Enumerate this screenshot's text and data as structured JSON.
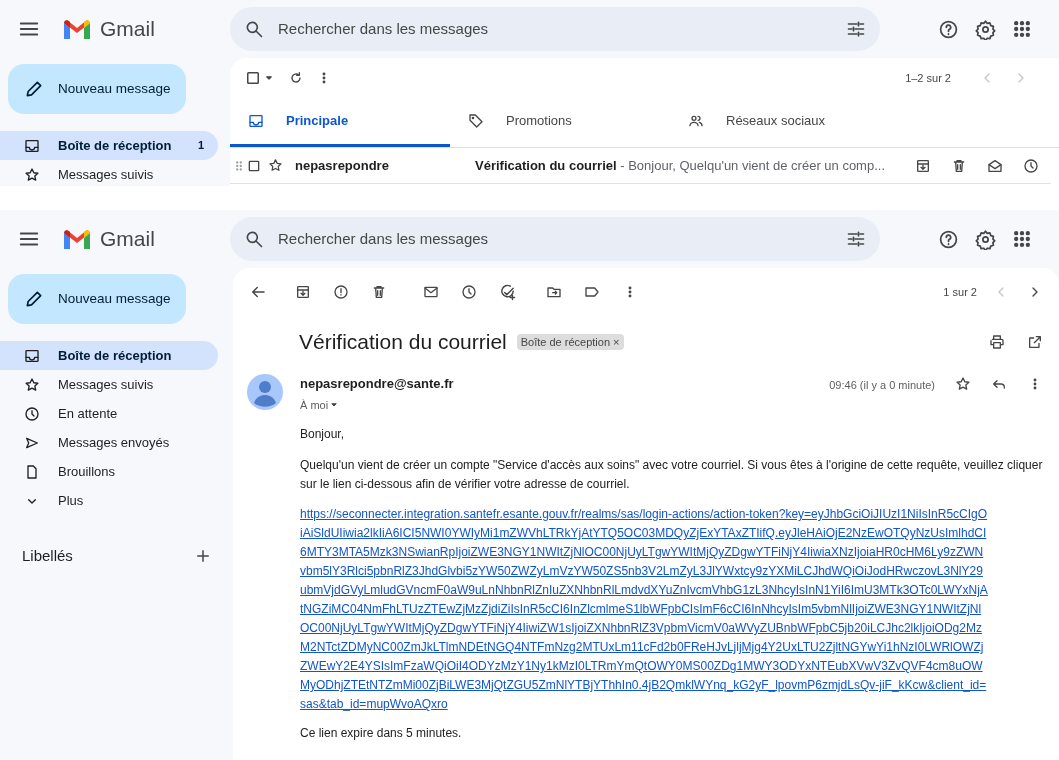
{
  "inbox_view": {
    "app_name": "Gmail",
    "search": {
      "placeholder": "Rechercher dans les messages"
    },
    "compose_label": "Nouveau message",
    "sidebar": {
      "items": [
        {
          "kind": "inbox",
          "label": "Boîte de réception",
          "count": "1",
          "selected": true
        },
        {
          "kind": "starred",
          "label": "Messages suivis",
          "selected": false
        }
      ]
    },
    "pagination": "1–2 sur 2",
    "tabs": [
      {
        "kind": "inbox",
        "label": "Principale",
        "selected": true
      },
      {
        "kind": "tag",
        "label": "Promotions",
        "selected": false
      },
      {
        "kind": "people",
        "label": "Réseaux sociaux",
        "selected": false
      }
    ],
    "rows": [
      {
        "sender": "nepasrepondre",
        "subject": "Vérification du courriel",
        "snippet": "- Bonjour, Quelqu'un vient de créer un comp...",
        "unread": true
      }
    ]
  },
  "message_view": {
    "app_name": "Gmail",
    "search": {
      "placeholder": "Rechercher dans les messages"
    },
    "compose_label": "Nouveau message",
    "sidebar": {
      "items": [
        {
          "kind": "inbox",
          "label": "Boîte de réception",
          "selected": true
        },
        {
          "kind": "starred",
          "label": "Messages suivis",
          "selected": false
        },
        {
          "kind": "snoozed",
          "label": "En attente",
          "selected": false
        },
        {
          "kind": "sent",
          "label": "Messages envoyés",
          "selected": false
        },
        {
          "kind": "drafts",
          "label": "Brouillons",
          "selected": false
        },
        {
          "kind": "more",
          "label": "Plus",
          "selected": false
        }
      ],
      "labels_heading": "Libellés"
    },
    "pagination": "1 sur 2",
    "subject": "Vérification du courriel",
    "label_chip": "Boîte de réception",
    "chip_close": "×",
    "sender": "nepasrepondre@sante.fr",
    "recipient": "À moi",
    "time": "09:46 (il y a 0 minute)",
    "body": {
      "greeting": "Bonjour,",
      "paragraph": "Quelqu'un vient de créer un compte \"Service d'accès aux soins\" avec votre courriel. Si vous êtes à l'origine de cette requête, veuillez cliquer sur le lien ci-dessous afin de vérifier votre adresse de courriel.",
      "link": "https://seconnecter.integration.santefr.esante.gouv.fr/realms/sas/login-actions/action-token?key=eyJhbGciOiJIUzI1NiIsInR5cCIgOiAiSldUIiwia2lkIiA6ICI5NWI0YWIyMi1mZWVhLTRkYjAtYTQ5OC03MDQyZjExYTAxZTIifQ.eyJleHAiOjE2NzEwOTQyNzUsImlhdCI6MTY3MTA5Mzk3NSwianRpIjoiZWE3NGY1NWItZjNlOC00NjUyLTgwYWItMjQyZDgwYTFiNjY4IiwiaXNzIjoiaHR0cHM6Ly9zZWNvbm5lY3Rlci5pbnRlZ3JhdGlvbi5zYW50ZWZyLmVzYW50ZS5nb3V2LmZyL3JlYWxtcy9zYXMiLCJhdWQiOiJodHRwczovL3NlY29ubmVjdGVyLmludGVncmF0aW9uLnNhbnRlZnIuZXNhbnRlLmdvdXYuZnIvcmVhbG1zL3NhcyIsInN1YiI6ImU3MTk3OTc0LWYxNjAtNGZiMC04NmFhLTUzZTEwZjMzZjdiZiIsInR5cCI6InZlcmlmeS1lbWFpbCIsImF6cCI6InNhcyIsIm5vbmNlIjoiZWE3NGY1NWItZjNlOC00NjUyLTgwYWItMjQyZDgwYTFiNjY4IiwiZW1sIjoiZXNhbnRlZ3VpbmVicmV0aWVyZUBnbWFpbC5jb20iLCJhc2lkIjoiODg2MzM2NTctZDMyNC00ZmJkLTlmNDEtNGQ4NTFmNzg2MTUxLm11cFd2b0FReHJvLjljMjg4Y2UxLTU2ZjltNGYwYi1hNzI0LWRlOWZjZWEwY2E4YSIsImFzaWQiOiI4ODYzMzY1Ny1kMzI0LTRmYmQtOWY0MS00ZDg1MWY3ODYxNTEubXVwV3ZvQVF4cm8uOWMyODhjZTEtNTZmMi00ZjBiLWE3MjQtZGU5ZmNlYTBjYThhIn0.4jB2QmklWYnq_kG2yF_lpovmP6zmjdLsQv-jiF_kKcw&client_id=sas&tab_id=mupWvoAQxro",
      "footer": "Ce lien expire dans 5 minutes."
    }
  }
}
